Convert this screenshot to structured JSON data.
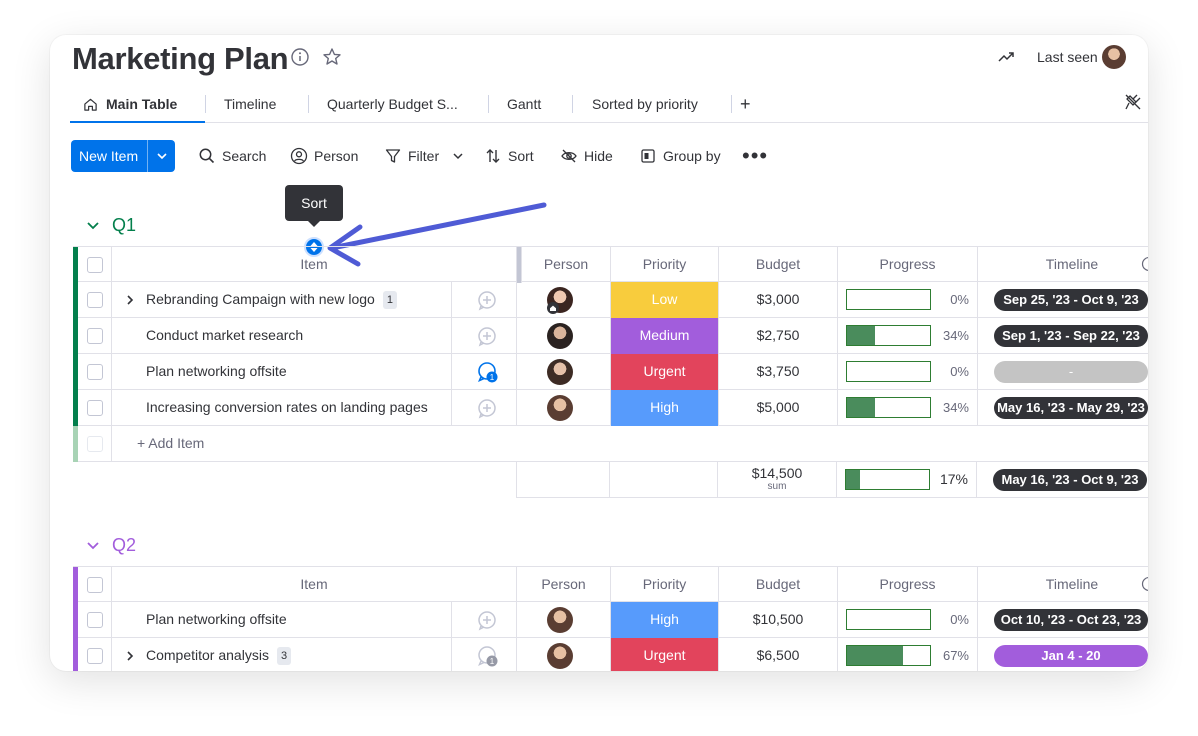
{
  "app": {
    "title": "Marketing Plan",
    "last_seen_label": "Last seen"
  },
  "tabs": [
    {
      "label": "Main Table",
      "active": true
    },
    {
      "label": "Timeline"
    },
    {
      "label": "Quarterly Budget S..."
    },
    {
      "label": "Gantt"
    },
    {
      "label": "Sorted by priority"
    }
  ],
  "tab_add_label": "+",
  "toolbar": {
    "new_item_label": "New Item",
    "search_label": "Search",
    "person_label": "Person",
    "filter_label": "Filter",
    "sort_label": "Sort",
    "hide_label": "Hide",
    "group_by_label": "Group by",
    "more_label": "•••"
  },
  "tooltip": {
    "text": "Sort"
  },
  "columns": {
    "item": "Item",
    "person": "Person",
    "priority": "Priority",
    "budget": "Budget",
    "progress": "Progress",
    "timeline": "Timeline"
  },
  "colors": {
    "accent": "#0073ea",
    "q1": "#037f4c",
    "q2": "#a25ddc",
    "low": "#f8cc3d",
    "medium": "#a25ddc",
    "urgent": "#e2445c",
    "high": "#579bfc",
    "timeline_dark": "#323338",
    "timeline_empty": "#c4c4c4",
    "timeline_purple": "#a25ddc"
  },
  "groups": [
    {
      "name": "Q1",
      "rows": [
        {
          "item": "Rebranding Campaign with new logo",
          "subitems": "1",
          "priority": "Low",
          "priority_color": "#f8cc3d",
          "budget": "$3,000",
          "progress": "0%",
          "progress_value": 0,
          "timeline": "Sep 25, '23 - Oct 9, '23",
          "timeline_color": "#323338"
        },
        {
          "item": "Conduct market research",
          "priority": "Medium",
          "priority_color": "#a25ddc",
          "budget": "$2,750",
          "progress": "34%",
          "progress_value": 34,
          "timeline": "Sep 1, '23 - Sep 22, '23",
          "timeline_color": "#323338"
        },
        {
          "item": "Plan networking offsite",
          "updates": "1",
          "priority": "Urgent",
          "priority_color": "#e2445c",
          "budget": "$3,750",
          "progress": "0%",
          "progress_value": 0,
          "timeline": "-",
          "timeline_color": "#c4c4c4"
        },
        {
          "item": "Increasing conversion rates on landing pages",
          "priority": "High",
          "priority_color": "#579bfc",
          "budget": "$5,000",
          "progress": "34%",
          "progress_value": 34,
          "timeline": "May 16, '23 - May 29, '23",
          "timeline_color": "#323338"
        }
      ],
      "add_item_label": "+ Add Item",
      "summary": {
        "budget": "$14,500",
        "budget_sub": "sum",
        "progress": "17%",
        "progress_value": 17,
        "timeline": "May 16, '23 - Oct 9, '23"
      }
    },
    {
      "name": "Q2",
      "rows": [
        {
          "item": "Plan networking offsite",
          "priority": "High",
          "priority_color": "#579bfc",
          "budget": "$10,500",
          "progress": "0%",
          "progress_value": 0,
          "timeline": "Oct 10, '23 - Oct 23, '23",
          "timeline_color": "#323338"
        },
        {
          "item": "Competitor analysis",
          "subitems": "3",
          "updates": "1",
          "priority": "Urgent",
          "priority_color": "#e2445c",
          "budget": "$6,500",
          "progress": "67%",
          "progress_value": 67,
          "timeline": "Jan 4 - 20",
          "timeline_color": "#a25ddc"
        }
      ]
    }
  ]
}
